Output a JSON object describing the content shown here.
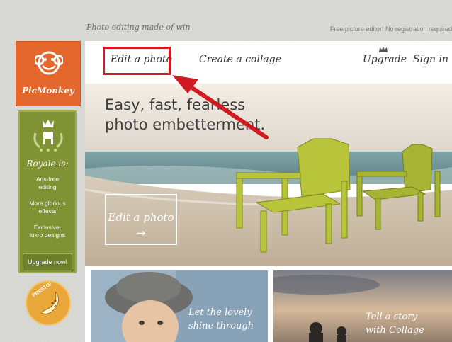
{
  "header": {
    "tagline": "Photo editing made of win",
    "notice": "Free picture editor! No registration required"
  },
  "brand": {
    "name": "PicMonkey"
  },
  "sidebar": {
    "royale_title": "Royale is:",
    "royale_items": [
      "Ads-free\nediting",
      "More glorious\neffects",
      "Exclusive,\nlux-o designs"
    ],
    "upgrade_button": "Upgrade now!",
    "presto_badge": "PRESTO!"
  },
  "nav": {
    "edit_photo": "Edit a photo",
    "create_collage": "Create a collage",
    "upgrade": "Upgrade",
    "sign_in": "Sign in"
  },
  "hero": {
    "headline_line1": "Easy, fast, fearless",
    "headline_line2": "photo embetterment.",
    "cta_label": "Edit a photo",
    "cta_arrow": "→"
  },
  "cards": {
    "left_text_line1": "Let the lovely",
    "left_text_line2": "shine through",
    "right_text_line1": "Tell a story",
    "right_text_line2": "with Collage"
  },
  "colors": {
    "brand_orange": "#e4682d",
    "royale_green": "#7f9334",
    "annotation_red": "#d11a22",
    "presto_yellow": "#eba83a"
  },
  "icons": {
    "logo": "monkey-face-icon",
    "royale_emblem": "crown-laurel-icon",
    "upgrade_crown": "crown-icon",
    "presto": "banana-mascot-icon"
  }
}
